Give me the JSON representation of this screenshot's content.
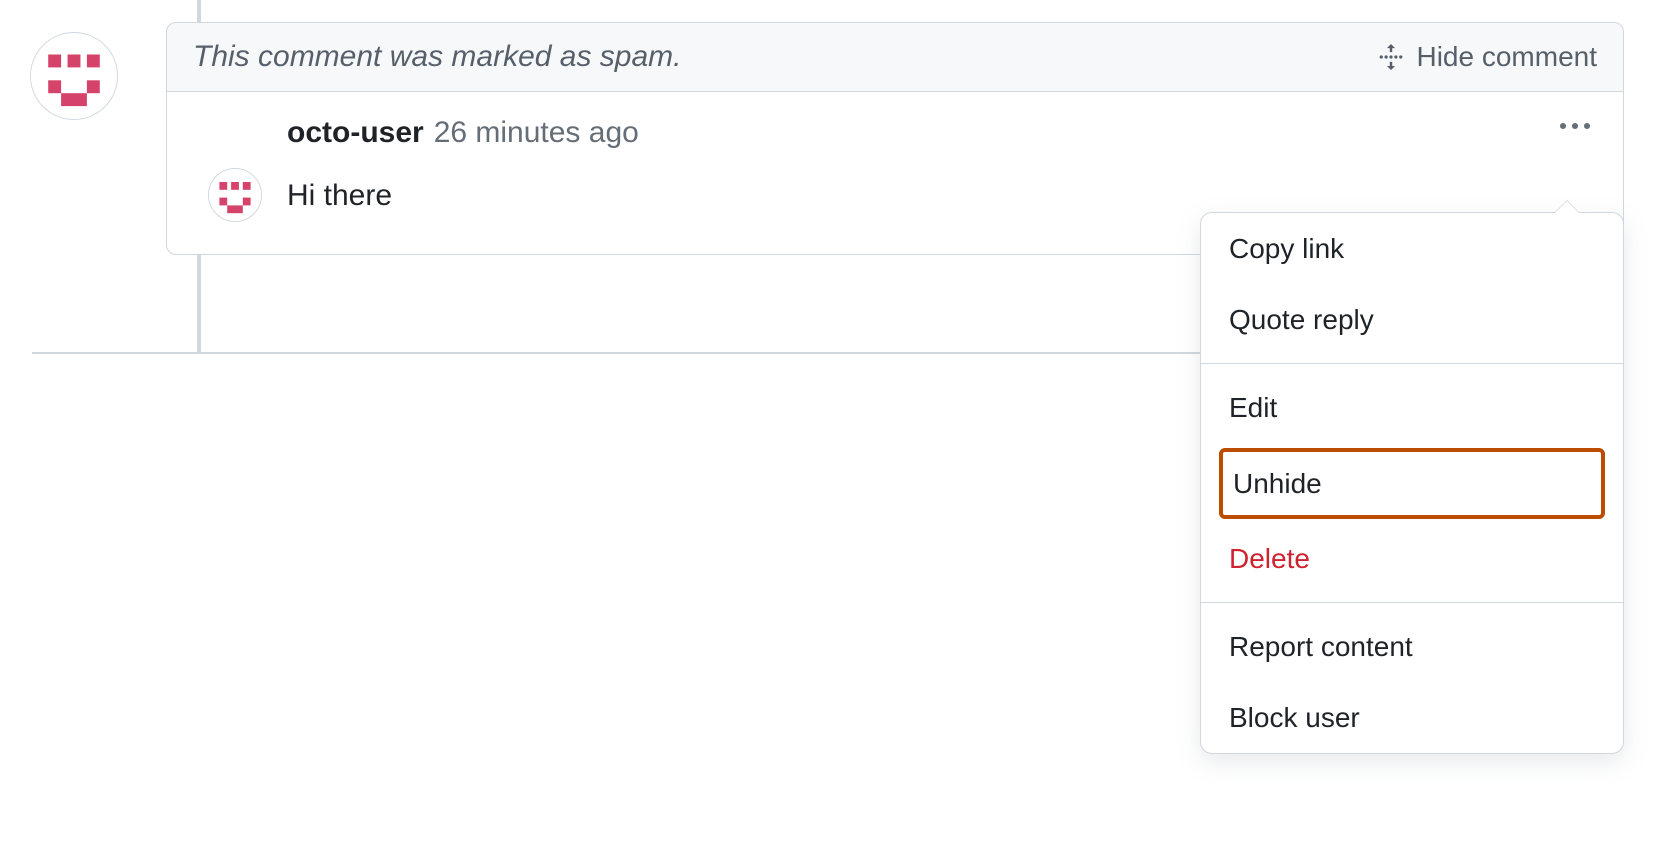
{
  "comment": {
    "status_text": "This comment was marked as spam.",
    "hide_button_label": "Hide comment",
    "author": "octo-user",
    "timestamp": "26 minutes ago",
    "body": "Hi there"
  },
  "icons": {
    "fold": "fold-icon",
    "kebab": "kebab-icon",
    "identicon": "identicon"
  },
  "menu": {
    "copy_link": "Copy link",
    "quote_reply": "Quote reply",
    "edit": "Edit",
    "unhide": "Unhide",
    "delete": "Delete",
    "report": "Report content",
    "block": "Block user"
  },
  "colors": {
    "border": "#d0d7de",
    "header_bg": "#f6f8fa",
    "muted_text": "#57606a",
    "danger": "#cf222e",
    "highlight": "#bc4c00",
    "identicon_fill": "#d5436a"
  }
}
